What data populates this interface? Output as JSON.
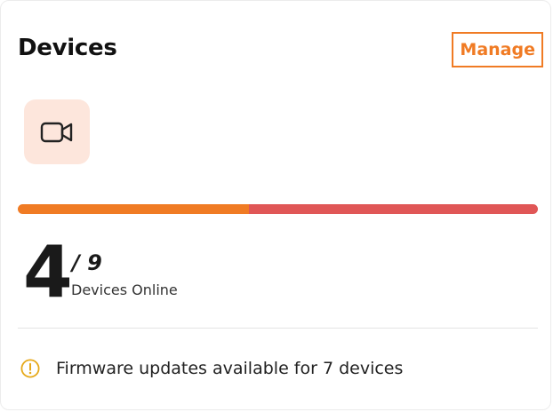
{
  "card": {
    "title": "Devices",
    "manage_label": "Manage"
  },
  "device_icon": {
    "name": "video-camera-icon"
  },
  "progress": {
    "online": 4,
    "total": 9,
    "online_color": "#f07b24",
    "offline_color": "#e05656"
  },
  "stats": {
    "online_count": "4",
    "total_text": "/ 9",
    "label": "Devices Online"
  },
  "notice": {
    "icon": "warning-circle-icon",
    "icon_color": "#e6a91a",
    "text": "Firmware updates available for 7 devices"
  },
  "colors": {
    "accent": "#f07b24",
    "icon_tile_background": "#fde6dc"
  }
}
